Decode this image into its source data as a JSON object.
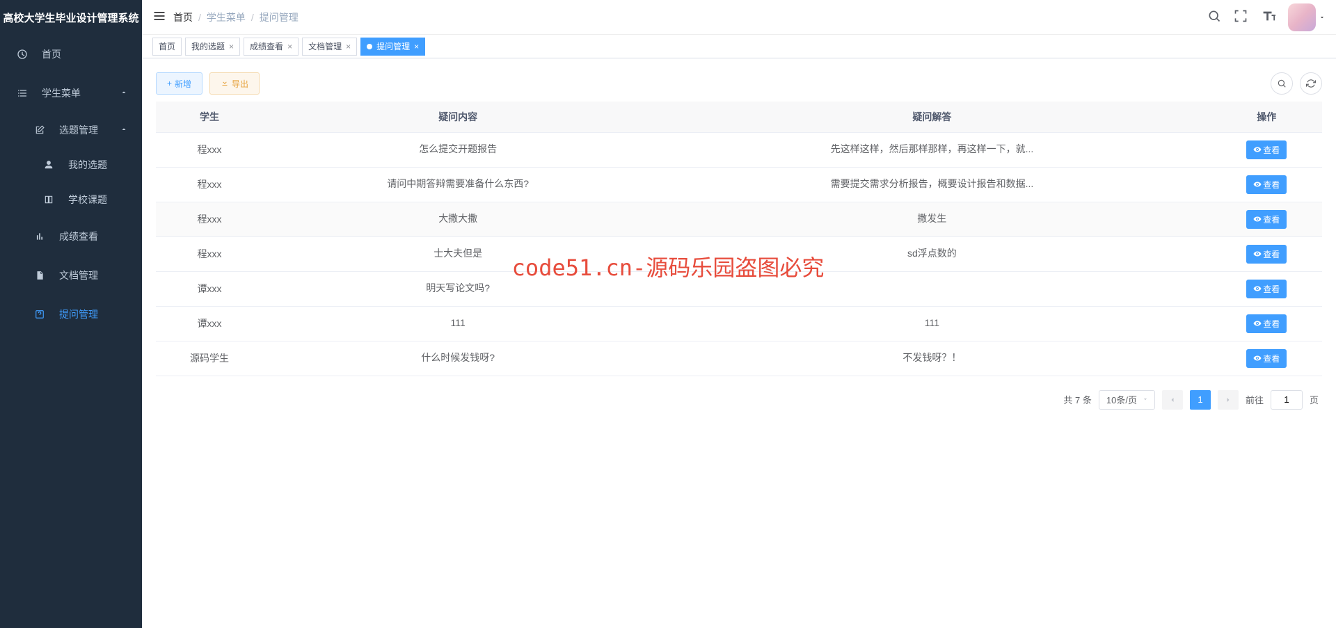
{
  "app_title": "高校大学生毕业设计管理系统",
  "breadcrumb": {
    "home": "首页",
    "menu": "学生菜单",
    "page": "提问管理"
  },
  "sidebar": {
    "home": "首页",
    "student_menu": "学生菜单",
    "topic_mgmt": "选题管理",
    "my_topic": "我的选题",
    "school_topic": "学校课题",
    "grade_view": "成绩查看",
    "doc_mgmt": "文档管理",
    "qa_mgmt": "提问管理"
  },
  "tabs": [
    {
      "label": "首页",
      "closable": false
    },
    {
      "label": "我的选题",
      "closable": true
    },
    {
      "label": "成绩查看",
      "closable": true
    },
    {
      "label": "文档管理",
      "closable": true
    },
    {
      "label": "提问管理",
      "closable": true,
      "active": true
    }
  ],
  "toolbar": {
    "add": "新增",
    "export": "导出"
  },
  "table": {
    "headers": {
      "student": "学生",
      "question": "疑问内容",
      "answer": "疑问解答",
      "action": "操作"
    },
    "view_label": "查看",
    "rows": [
      {
        "student": "程xxx",
        "question": "怎么提交开题报告",
        "answer": "先这样这样，然后那样那样，再这样一下，就..."
      },
      {
        "student": "程xxx",
        "question": "请问中期答辩需要准备什么东西?",
        "answer": "需要提交需求分析报告，概要设计报告和数据..."
      },
      {
        "student": "程xxx",
        "question": "大撒大撒",
        "answer": "撒发生"
      },
      {
        "student": "程xxx",
        "question": "士大夫但是",
        "answer": "sd浮点数的"
      },
      {
        "student": "谭xxx",
        "question": "明天写论文吗?",
        "answer": ""
      },
      {
        "student": "谭xxx",
        "question": "111",
        "answer": "111"
      },
      {
        "student": "源码学生",
        "question": "什么时候发钱呀?",
        "answer": "不发钱呀？！"
      }
    ]
  },
  "pagination": {
    "total_text": "共 7 条",
    "page_size": "10条/页",
    "current": "1",
    "goto_prefix": "前往",
    "goto_value": "1",
    "goto_suffix": "页"
  },
  "watermark": "code51.cn-源码乐园盗图必究"
}
